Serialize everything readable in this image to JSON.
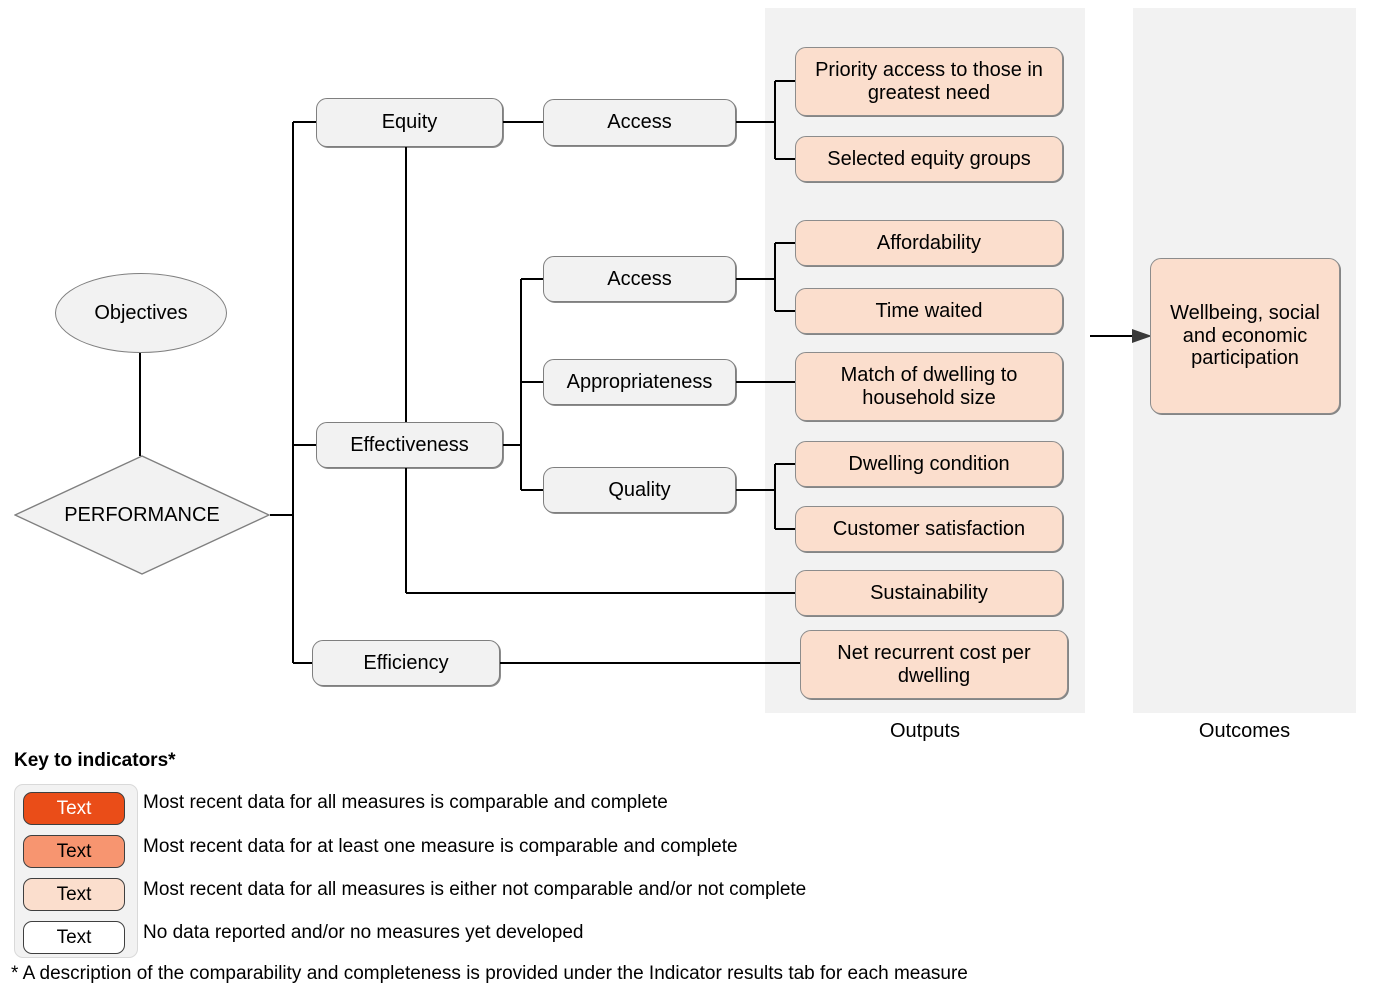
{
  "columns": {
    "outputs_label": "Outputs",
    "outcomes_label": "Outcomes"
  },
  "nodes": {
    "objectives": "Objectives",
    "performance": "PERFORMANCE",
    "equity": "Equity",
    "effectiveness": "Effectiveness",
    "efficiency": "Efficiency",
    "equity_access": "Access",
    "eff_access": "Access",
    "appropriateness": "Appropriateness",
    "quality": "Quality"
  },
  "outputs": {
    "priority_access": "Priority access to those in greatest need",
    "selected_equity_groups": "Selected equity groups",
    "affordability": "Affordability",
    "time_waited": "Time waited",
    "match_dwelling": "Match of dwelling to household size",
    "dwelling_condition": "Dwelling condition",
    "customer_satisfaction": "Customer satisfaction",
    "sustainability": "Sustainability",
    "net_recurrent_cost": "Net recurrent cost per dwelling"
  },
  "outcomes": {
    "wellbeing": "Wellbeing, social and economic participation"
  },
  "legend": {
    "title": "Key to indicators*",
    "swatch_label": "Text",
    "items": [
      {
        "label": "Text",
        "color": "#ea4d18",
        "text_color": "#ffffff",
        "description": "Most recent data for all measures is comparable and complete"
      },
      {
        "label": "Text",
        "color": "#f79570",
        "text_color": "#000000",
        "description": "Most recent data for at least one measure is comparable and complete"
      },
      {
        "label": "Text",
        "color": "#fbdecd",
        "text_color": "#000000",
        "description": "Most recent data for all measures is either not comparable and/or not complete"
      },
      {
        "label": "Text",
        "color": "#ffffff",
        "text_color": "#000000",
        "description": "No data reported and/or no measures yet developed"
      }
    ],
    "footnote": "* A description of the comparability and completeness is provided under the Indicator results tab for each measure"
  },
  "colors": {
    "band": "#f2f2f2",
    "node_fill": "#f2f2f2",
    "output_fill": "#fbdecd",
    "border": "#7f7f7f",
    "line": "#000000"
  }
}
